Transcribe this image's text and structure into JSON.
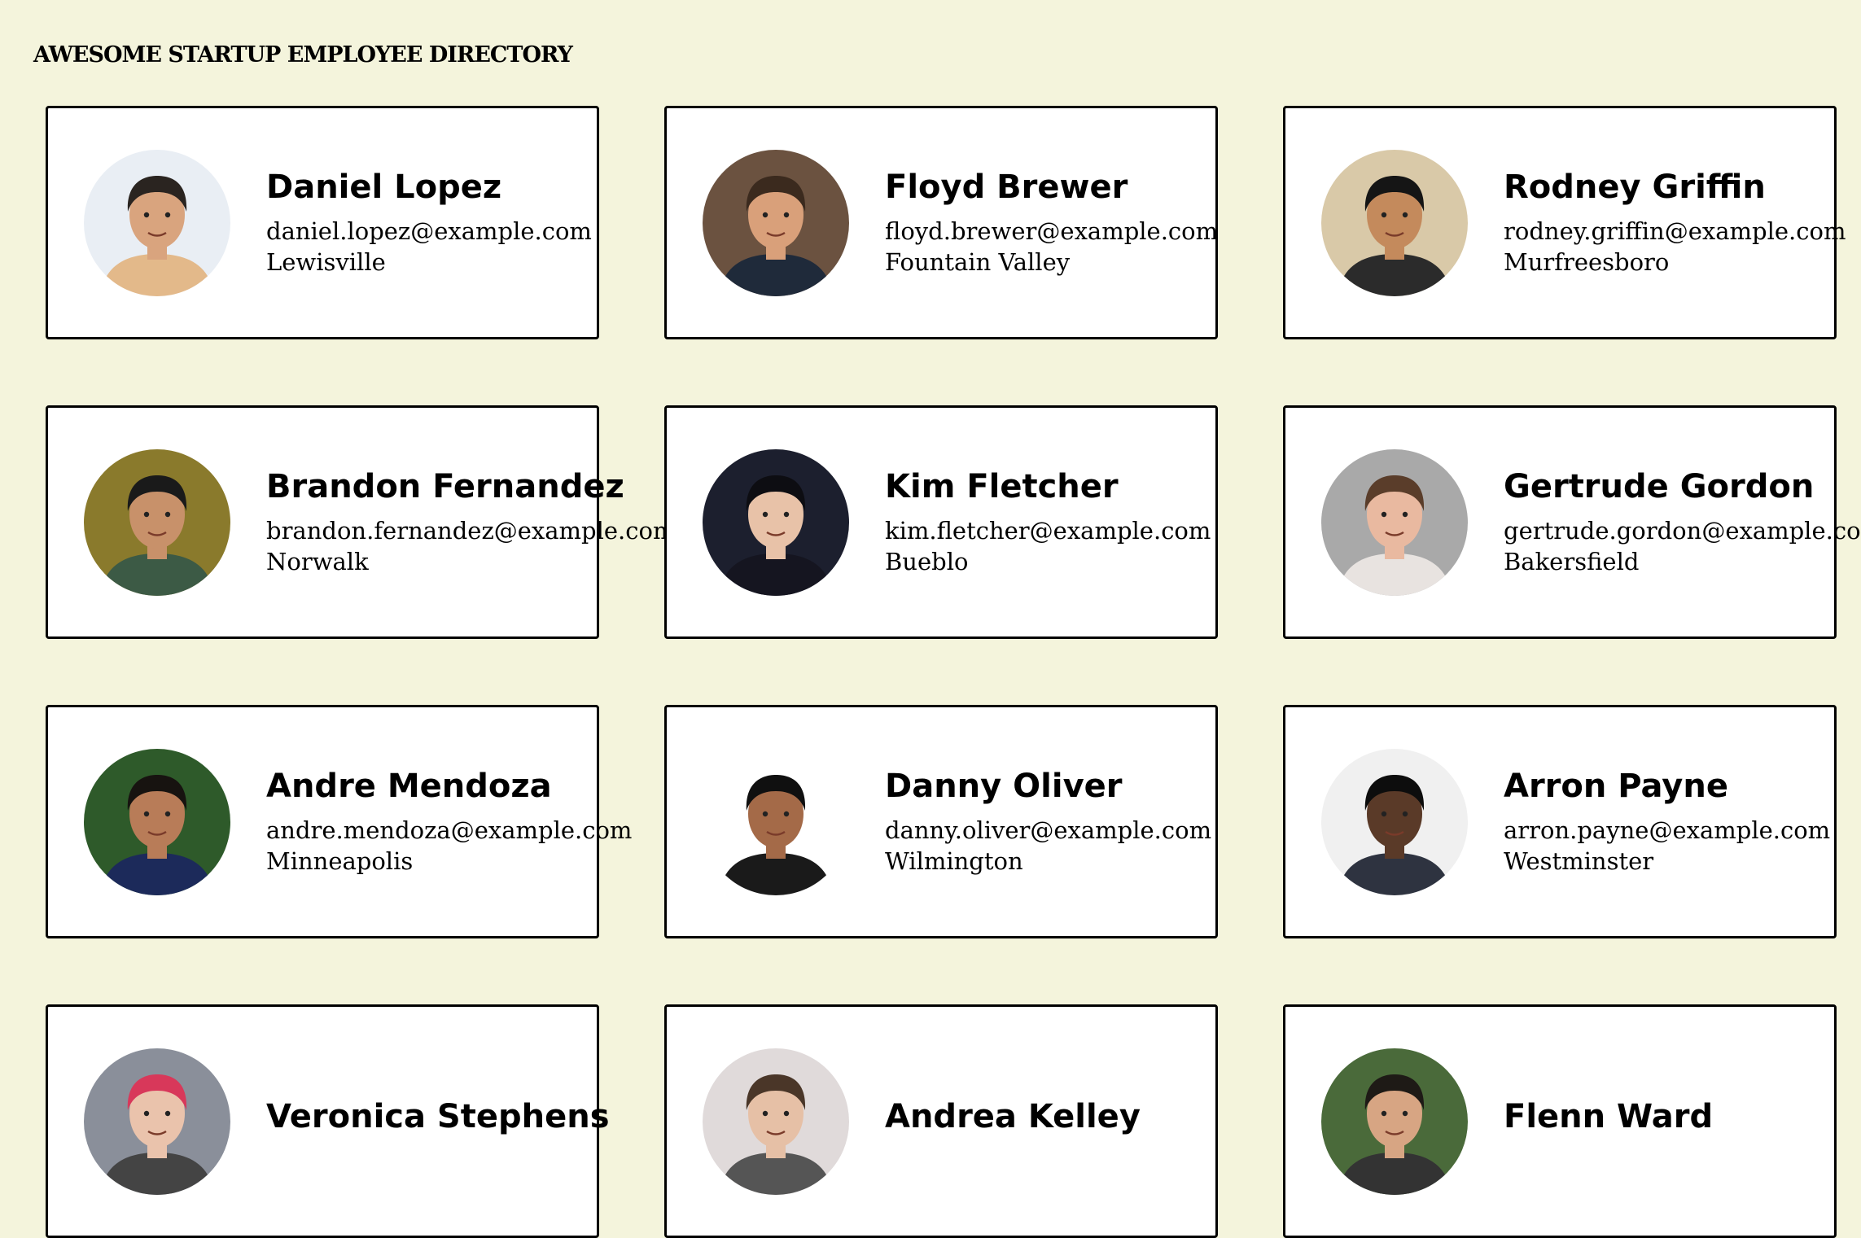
{
  "page": {
    "title": "AWESOME STARTUP EMPLOYEE DIRECTORY",
    "background": "#f4f4dc"
  },
  "employees": [
    {
      "name": "Daniel Lopez",
      "email": "daniel.lopez@example.com",
      "city": "Lewisville",
      "photo": {
        "bg": "#e9eef4",
        "skin": "#d9a47e",
        "hair": "#2a2420",
        "shirt": "#e3b98a"
      }
    },
    {
      "name": "Floyd Brewer",
      "email": "floyd.brewer@example.com",
      "city": "Fountain Valley",
      "photo": {
        "bg": "#6b5240",
        "skin": "#d9a07a",
        "hair": "#3b2a1e",
        "shirt": "#1f2a3a"
      }
    },
    {
      "name": "Rodney Griffin",
      "email": "rodney.griffin@example.com",
      "city": "Murfreesboro",
      "photo": {
        "bg": "#d9c9a8",
        "skin": "#c48a5c",
        "hair": "#151515",
        "shirt": "#2b2b2b"
      }
    },
    {
      "name": "Brandon Fernandez",
      "email": "brandon.fernandez@example.com",
      "city": "Norwalk",
      "photo": {
        "bg": "#8a7a2c",
        "skin": "#c8916a",
        "hair": "#1a1a1a",
        "shirt": "#3c5a45"
      }
    },
    {
      "name": "Kim Fletcher",
      "email": "kim.fletcher@example.com",
      "city": "Bueblo",
      "photo": {
        "bg": "#1c1f2e",
        "skin": "#e8c2a8",
        "hair": "#0d0d12",
        "shirt": "#151520"
      }
    },
    {
      "name": "Gertrude Gordon",
      "email": "gertrude.gordon@example.com",
      "city": "Bakersfield",
      "photo": {
        "bg": "#a9a9a9",
        "skin": "#e9b9a0",
        "hair": "#5a3d2a",
        "shirt": "#e8e3e0"
      }
    },
    {
      "name": "Andre Mendoza",
      "email": "andre.mendoza@example.com",
      "city": "Minneapolis",
      "photo": {
        "bg": "#2e5a2a",
        "skin": "#b87c58",
        "hair": "#171310",
        "shirt": "#1c2a5a"
      }
    },
    {
      "name": "Danny Oliver",
      "email": "danny.oliver@example.com",
      "city": "Wilmington",
      "photo": {
        "bg": "#ffffff",
        "skin": "#a46a48",
        "hair": "#101010",
        "shirt": "#1a1a1a"
      }
    },
    {
      "name": "Arron Payne",
      "email": "arron.payne@example.com",
      "city": "Westminster",
      "photo": {
        "bg": "#f0f0f0",
        "skin": "#5a3a28",
        "hair": "#0d0d0d",
        "shirt": "#2e3340"
      }
    },
    {
      "name": "Veronica Stephens",
      "email": "",
      "city": "",
      "photo": {
        "bg": "#8a8f9a",
        "skin": "#eac3ac",
        "hair": "#d8385a",
        "shirt": "#444"
      }
    },
    {
      "name": "Andrea Kelley",
      "email": "",
      "city": "",
      "photo": {
        "bg": "#e0dada",
        "skin": "#e6c0a6",
        "hair": "#4a3628",
        "shirt": "#555"
      }
    },
    {
      "name": "Flenn Ward",
      "email": "",
      "city": "",
      "photo": {
        "bg": "#4a6a3a",
        "skin": "#d7a583",
        "hair": "#1e1a16",
        "shirt": "#333"
      }
    }
  ]
}
